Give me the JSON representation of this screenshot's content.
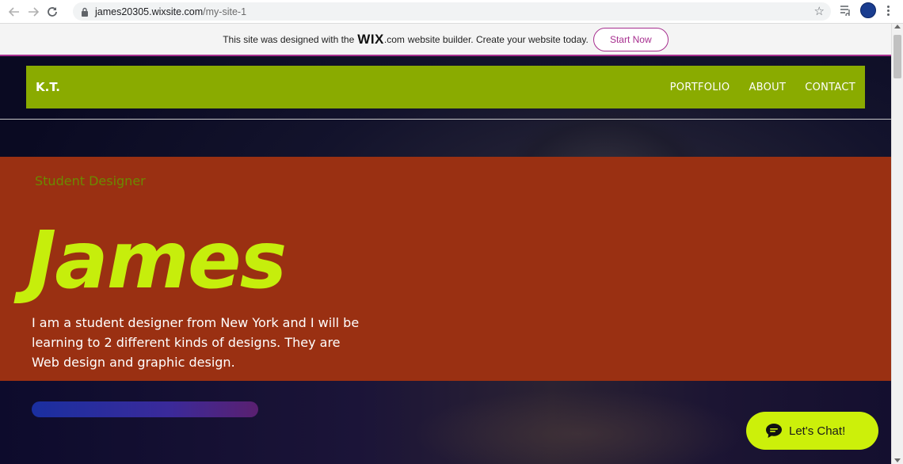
{
  "browser": {
    "url_domain": "james20305.wixsite.com",
    "url_path": "/my-site-1",
    "icons": {
      "back": "back-arrow-icon",
      "forward": "forward-arrow-icon",
      "reload": "reload-icon",
      "lock": "lock-icon",
      "star": "bookmark-star-icon",
      "media": "media-queue-icon",
      "profile": "profile-avatar-icon",
      "menu": "kebab-menu-icon"
    }
  },
  "wix_banner": {
    "text_before": "This site was designed with the",
    "logo": "WIX",
    "logo_suffix": ".com",
    "text_after": "website builder. Create your website today.",
    "cta": "Start Now",
    "accent_color": "#a72f8f"
  },
  "site": {
    "logo": "K.T.",
    "menu": [
      "PORTFOLIO",
      "ABOUT",
      "CONTACT"
    ],
    "header_color": "#8aab00",
    "hero": {
      "subtitle": "Student Designer",
      "name": "James",
      "bio": "I am a student designer from New York and I will be\nlearning to 2 different kinds of designs.  They are\n Web design and graphic design.",
      "background_color": "#9a3012",
      "name_color": "#c6ee0c"
    },
    "chat": {
      "label": "Let's Chat!",
      "color": "#ccf00a"
    }
  }
}
